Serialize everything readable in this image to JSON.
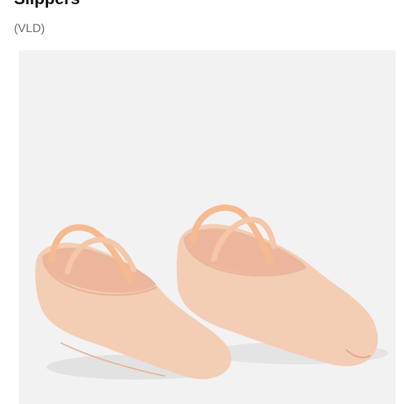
{
  "product": {
    "title": "Slippers",
    "code": "(VLD)",
    "image": {
      "subject": "pair-of-canvas-ballet-slippers",
      "colors": {
        "background": "#f2f2f2",
        "canvas": "#f4cdb5",
        "canvas_shade": "#e8b79c",
        "lining": "#eeb79d",
        "elastic": "#f7b98f"
      }
    }
  }
}
